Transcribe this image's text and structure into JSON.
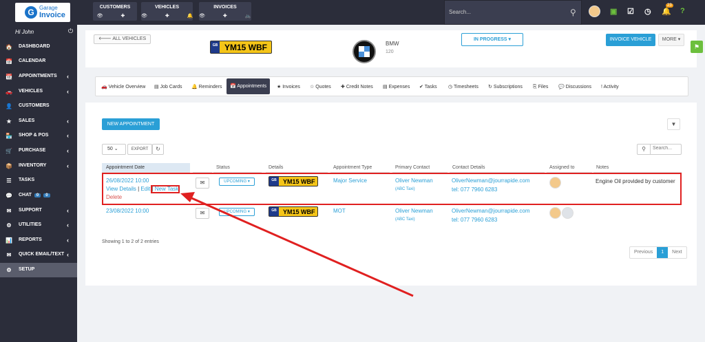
{
  "logo": {
    "line1": "Garage",
    "line2": "Invoice",
    "icon": "G"
  },
  "topnav": {
    "customers": {
      "label": "CUSTOMERS",
      "icons": "👁 ✚"
    },
    "vehicles": {
      "label": "VEHICLES",
      "icons": "👁 ✚ 🔔"
    },
    "invoices": {
      "label": "INVOICES",
      "icons": "👁 ✚ 🚲"
    }
  },
  "search": {
    "placeholder": "Search..."
  },
  "bell_count": "23",
  "sidebar": {
    "greeting": "Hi John",
    "items": [
      {
        "label": "DASHBOARD",
        "icon": "🏠"
      },
      {
        "label": "CALENDAR",
        "icon": "📅"
      },
      {
        "label": "APPOINTMENTS",
        "icon": "📆"
      },
      {
        "label": "VEHICLES",
        "icon": "🚗"
      },
      {
        "label": "CUSTOMERS",
        "icon": "👤"
      },
      {
        "label": "SALES",
        "icon": "★"
      },
      {
        "label": "SHOP & POS",
        "icon": "🏪"
      },
      {
        "label": "PURCHASE",
        "icon": "🛒"
      },
      {
        "label": "INVENTORY",
        "icon": "📦"
      },
      {
        "label": "TASKS",
        "icon": "☰"
      },
      {
        "label": "CHAT",
        "icon": "💬",
        "badges": [
          "0",
          "0"
        ]
      },
      {
        "label": "SUPPORT",
        "icon": "✉"
      },
      {
        "label": "UTILITIES",
        "icon": "⚙"
      },
      {
        "label": "REPORTS",
        "icon": "📊"
      },
      {
        "label": "QUICK EMAIL/TEXT",
        "icon": "✉"
      },
      {
        "label": "SETUP",
        "icon": "⚙"
      }
    ]
  },
  "vehicle": {
    "all_vehicles": "ALL VEHICLES",
    "plate_prefix": "GB",
    "plate": "YM15 WBF",
    "make": "BMW",
    "model": "120",
    "status": "IN PROGRESS ▾",
    "invoice_btn": "INVOICE VEHICLE",
    "more_btn": "MORE ▾"
  },
  "tabs": [
    {
      "label": "Vehicle Overview",
      "icon": "🚗"
    },
    {
      "label": "Job Cards",
      "icon": "▤"
    },
    {
      "label": "Reminders",
      "icon": "🔔"
    },
    {
      "label": "Appointments",
      "icon": "📅"
    },
    {
      "label": "Invoices",
      "icon": "★"
    },
    {
      "label": "Quotes",
      "icon": "☆"
    },
    {
      "label": "Credit Notes",
      "icon": "✚"
    },
    {
      "label": "Expenses",
      "icon": "▤"
    },
    {
      "label": "Tasks",
      "icon": "✔"
    },
    {
      "label": "Timesheets",
      "icon": "◷"
    },
    {
      "label": "Subscriptions",
      "icon": "↻"
    },
    {
      "label": "Files",
      "icon": "⎘"
    },
    {
      "label": "Discussions",
      "icon": "💬"
    },
    {
      "label": "Activity",
      "icon": "!"
    }
  ],
  "panel": {
    "new_appointment": "NEW APPOINTMENT",
    "page_size": "50",
    "export": "EXPORT",
    "search_placeholder": "Search...",
    "entries": "Showing 1 to 2 of 2 entries",
    "previous": "Previous",
    "page": "1",
    "next": "Next"
  },
  "table": {
    "headers": [
      "Appointment Date",
      "Status",
      "Details",
      "Appointment Type",
      "Primary Contact",
      "Contact Details",
      "Assigned to",
      "Notes"
    ],
    "rows": [
      {
        "date": "26/08/2022 10:00",
        "view": "View Details",
        "sep1": " | ",
        "edit": "Edit",
        "sep2": " | ",
        "new_task": "New Task",
        "delete": "Delete",
        "status": "UPCOMING ▾",
        "plate": "YM15 WBF",
        "type": "Major Service",
        "contact": "Oliver Newman",
        "company": "(ABC Taxi)",
        "email": "OliverNewman@jourrapide.com",
        "tel": "tel: 077 7960 6283",
        "notes": "Engine Oil provided by customer"
      },
      {
        "date": "23/08/2022 10:00",
        "status": "UPCOMING ▾",
        "plate": "YM15 WBF",
        "type": "MOT",
        "contact": "Oliver Newman",
        "company": "(ABC Taxi)",
        "email": "OliverNewman@jourrapide.com",
        "tel": "tel: 077 7960 6283",
        "notes": ""
      }
    ]
  },
  "colors": {
    "accent": "#2a9fd6",
    "highlight": "#e02020",
    "sidebar": "#2b2d3a",
    "plate": "#f5c518"
  }
}
